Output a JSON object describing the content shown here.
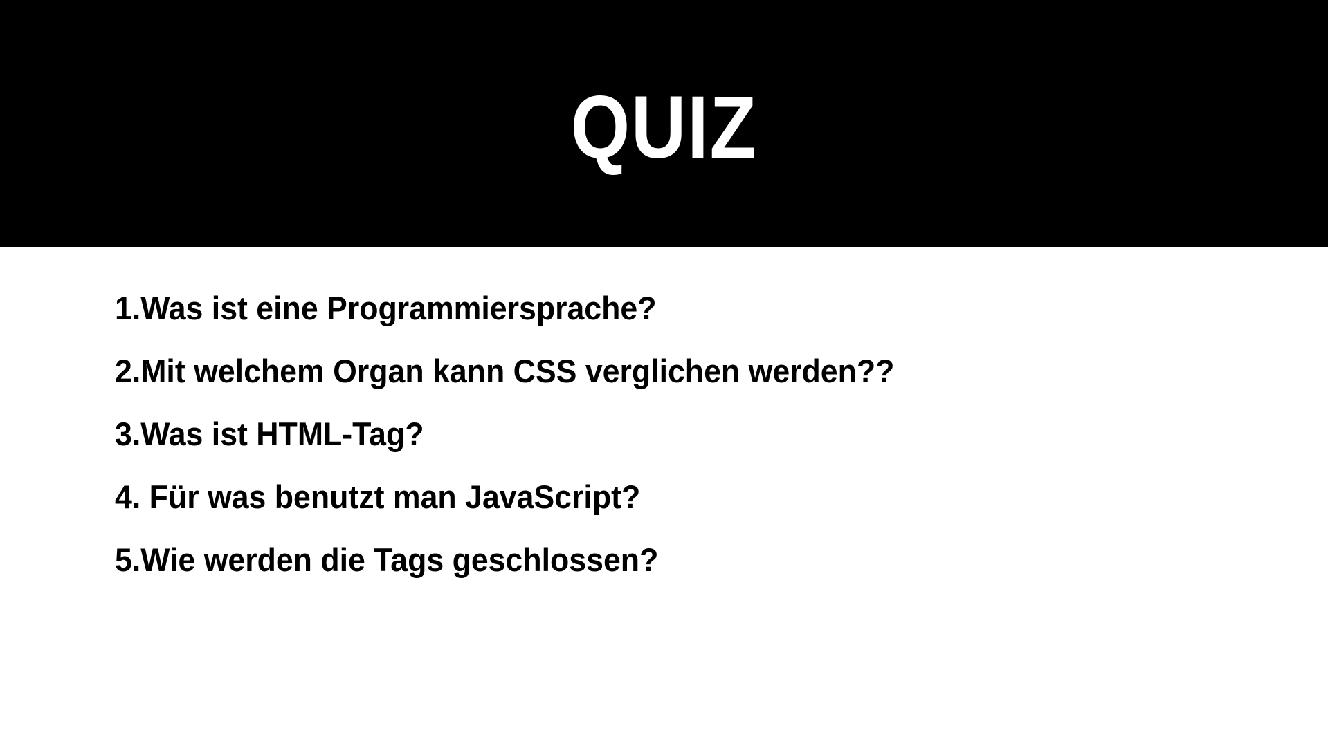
{
  "slide": {
    "title": "QUIZ",
    "colors": {
      "header_background": "#000000",
      "title_text": "#ffffff",
      "body_background": "#ffffff",
      "body_text": "#000000"
    },
    "questions": [
      "1.Was ist eine Programmiersprache?",
      "2.Mit welchem Organ kann CSS verglichen werden??",
      "3.Was ist HTML-Tag?",
      "4. Für was benutzt man JavaScript?",
      "5.Wie werden die Tags geschlossen?"
    ]
  }
}
